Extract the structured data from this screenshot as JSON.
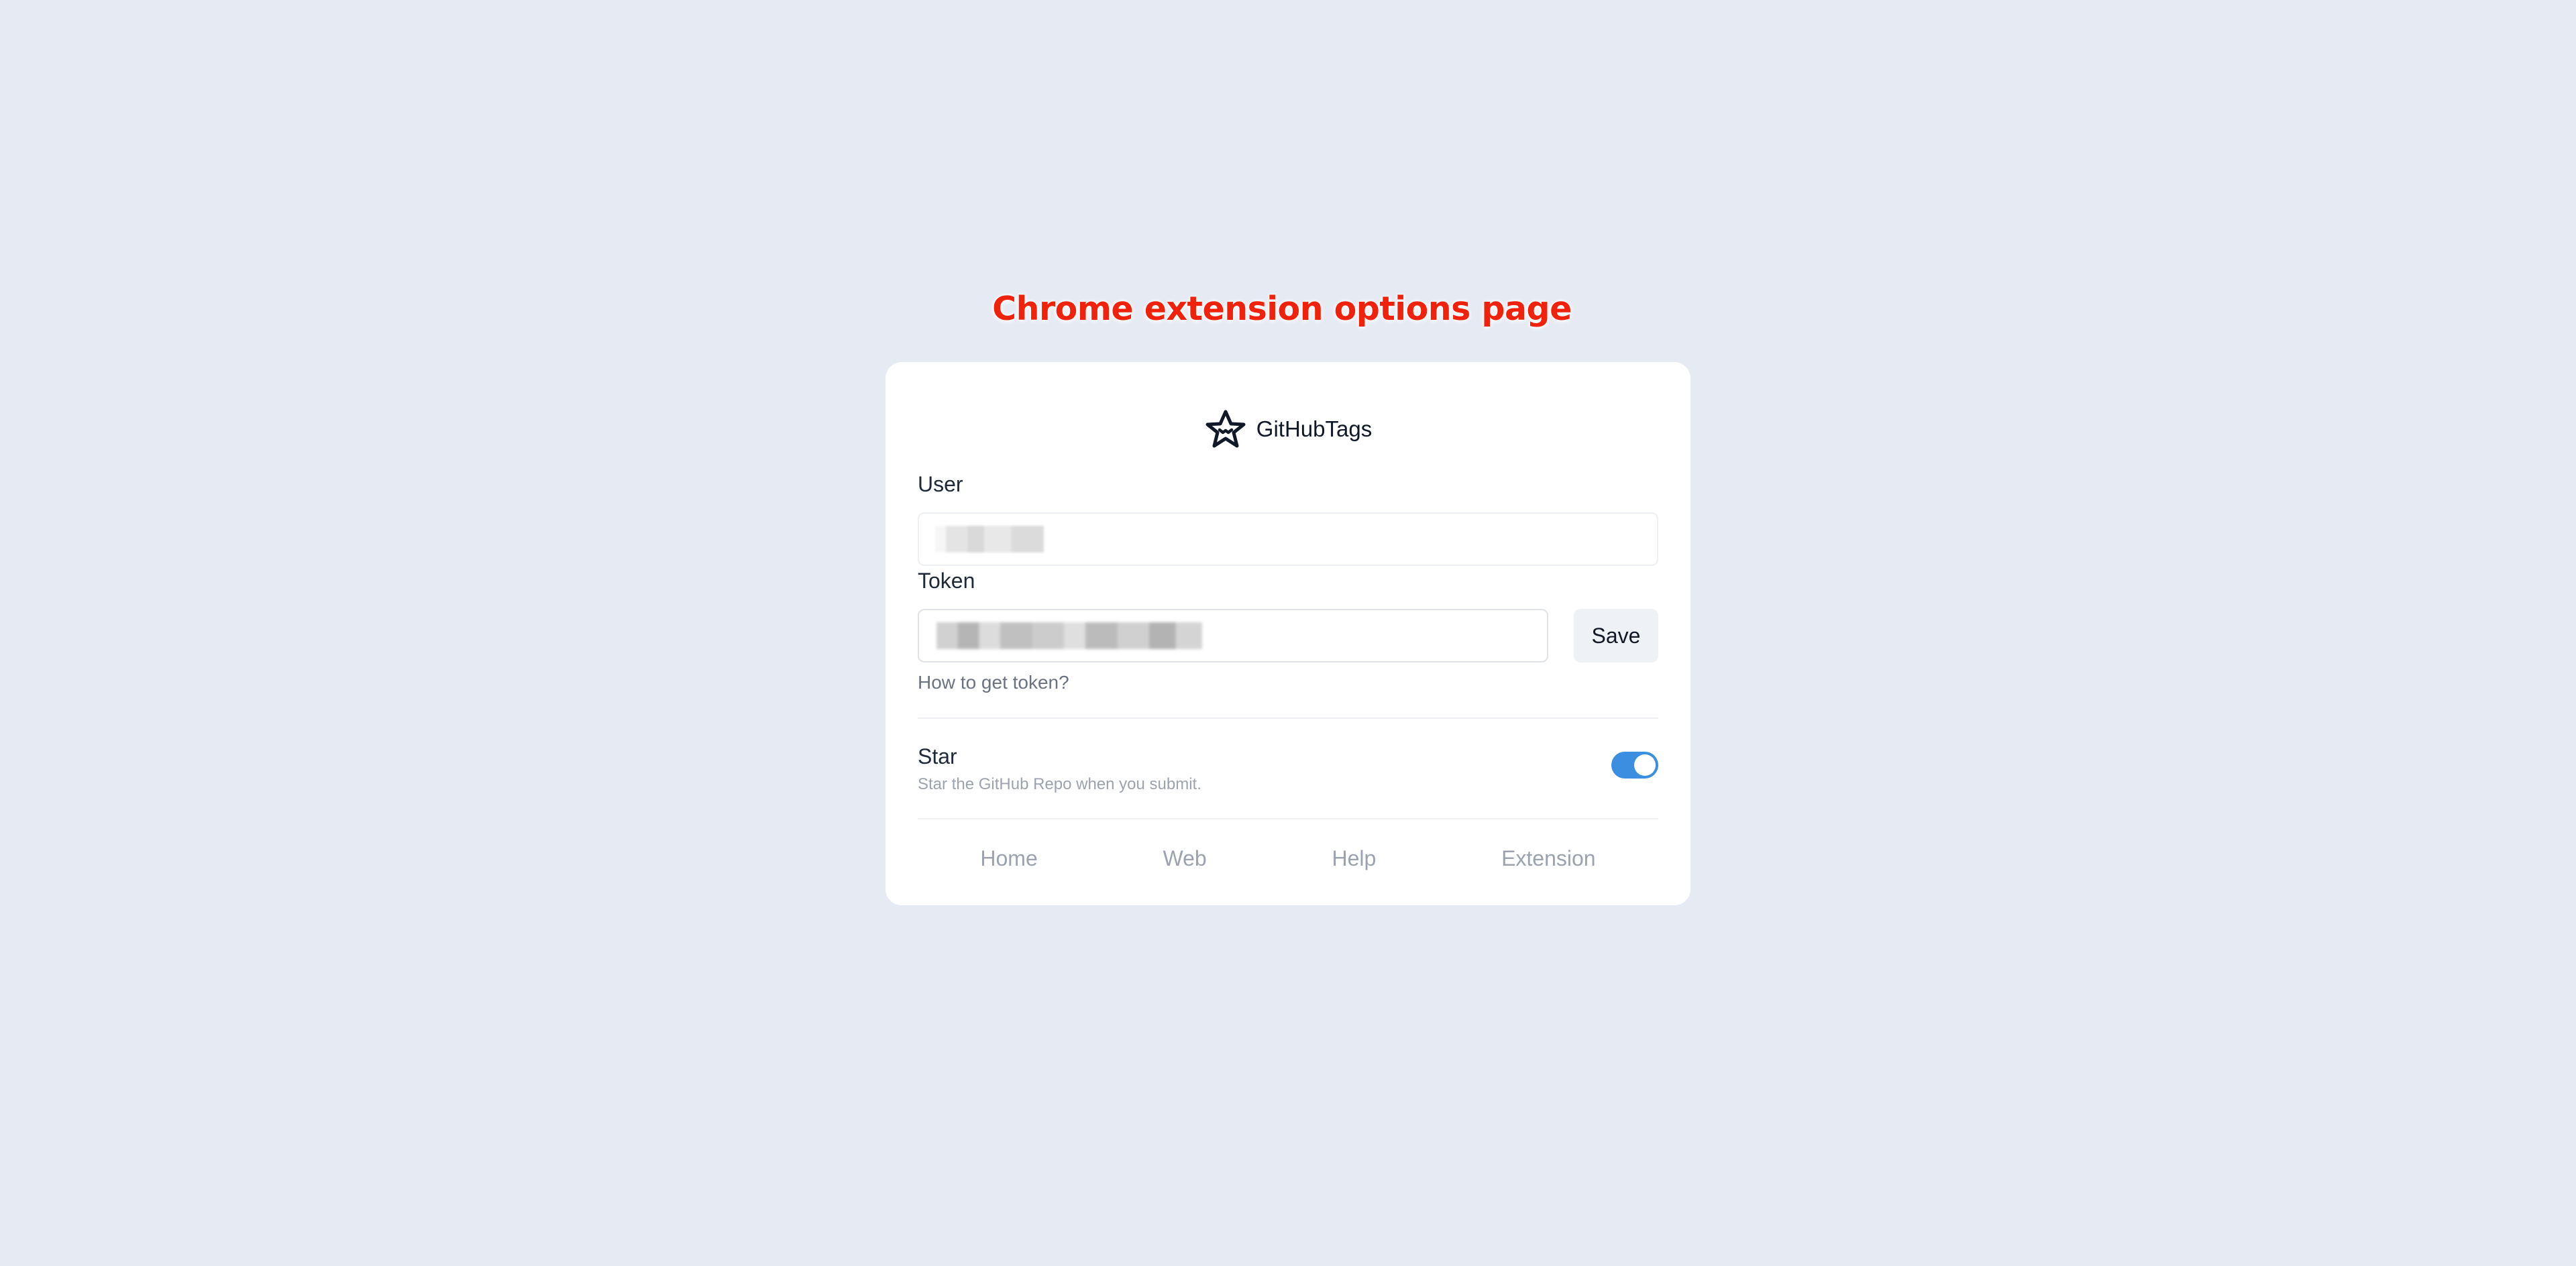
{
  "caption": "Chrome extension options page",
  "brand": {
    "name": "GitHubTags",
    "logo_icon": "star-face-icon"
  },
  "form": {
    "user_label": "User",
    "user_value": "",
    "token_label": "Token",
    "token_value": "",
    "save_label": "Save",
    "token_help": "How to get token?"
  },
  "settings": {
    "star": {
      "title": "Star",
      "description": "Star the GitHub Repo when you submit.",
      "enabled": true
    }
  },
  "footer": {
    "links": [
      "Home",
      "Web",
      "Help",
      "Extension"
    ]
  },
  "colors": {
    "background": "#e5eaf3",
    "toggle_on": "#3b8ee0",
    "caption": "#f0220c"
  }
}
